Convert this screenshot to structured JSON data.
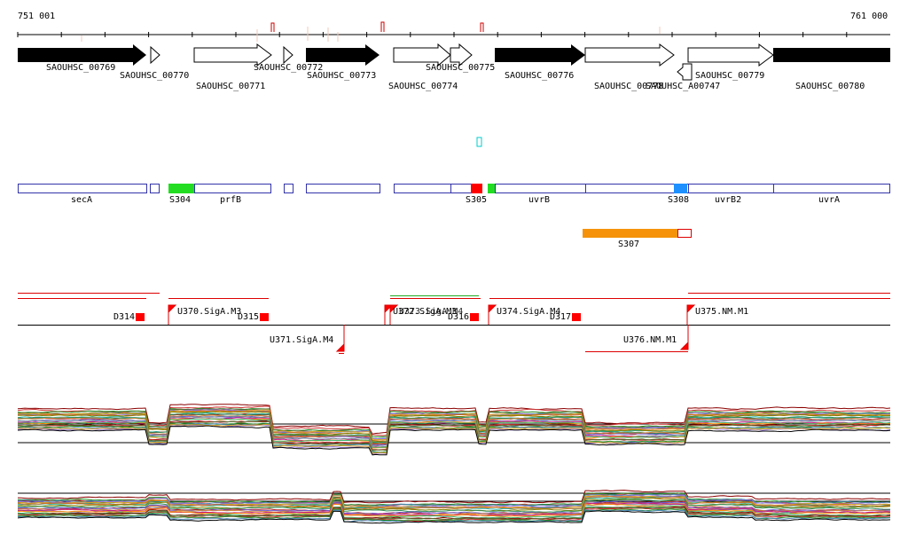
{
  "axis": {
    "start": "751 001",
    "end": "761 000"
  },
  "colors": {
    "feature_outline": "#3333aa",
    "srna_green": "#22dd22",
    "srna_red": "#ff0000",
    "srna_blue": "#1e90ff",
    "srna_orange": "#f5920a",
    "utr_red": "#dd0000",
    "utr_green": "#22aa22",
    "marker_cyan": "#00cccc"
  },
  "genes_upper_labels": [
    "SAOUHSC_00769",
    "SAOUHSC_00772",
    "SAOUHSC_00775",
    "SAOUHSC_00779"
  ],
  "genes_lower_labels": [
    "SAOUHSC_00770",
    "SAOUHSC_00773",
    "SAOUHSC_00776",
    "SAOUHSC_A00747"
  ],
  "genes_bottom_labels": [
    "SAOUHSC_00771",
    "SAOUHSC_00774",
    "SAOUHSC_00778",
    "SAOUHSC_00780"
  ],
  "features": {
    "gene_names": [
      "secA",
      "prfB",
      "uvrB",
      "uvrB2",
      "uvrA"
    ],
    "srna_names": [
      "S304",
      "S305",
      "S308",
      "S307"
    ]
  },
  "utr_labels": {
    "down": [
      "D314",
      "D315",
      "D316",
      "D317"
    ],
    "up": [
      "U370.SigA.M3",
      "U372.SigA.M3",
      "U373.SigA.M4",
      "U374.SigA.M4",
      "U375.NM.M1"
    ],
    "below": [
      "U371.SigA.M4",
      "U376.NM.M1"
    ]
  }
}
